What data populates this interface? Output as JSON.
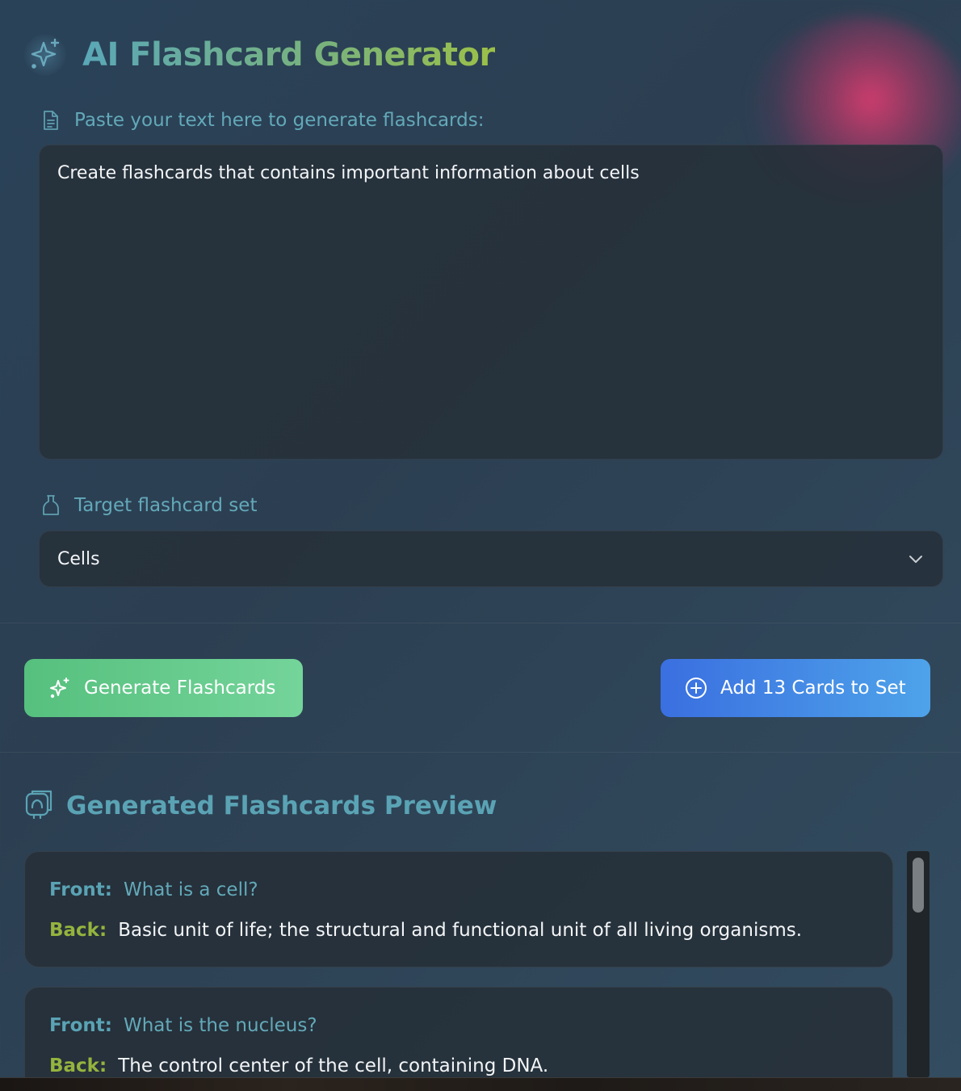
{
  "app": {
    "title": "AI Flashcard Generator",
    "title_icon": "sparkles-icon"
  },
  "input_section": {
    "label": "Paste your text here to generate flashcards:",
    "label_icon": "document-icon",
    "text_value": "Create flashcards that contains important information about cells"
  },
  "target_section": {
    "label": "Target flashcard set",
    "label_icon": "flask-icon",
    "selected_value": "Cells",
    "dropdown_icon": "chevron-down-icon"
  },
  "actions": {
    "generate_label": "Generate Flashcards",
    "generate_icon": "sparkles-icon",
    "add_label": "Add 13 Cards to Set",
    "add_icon": "plus-circle-icon"
  },
  "preview": {
    "title": "Generated Flashcards Preview",
    "icon": "cards-icon",
    "front_key": "Front:",
    "back_key": "Back:",
    "cards": [
      {
        "front": "What is a cell?",
        "back": "Basic unit of life; the structural and functional unit of all living organisms."
      },
      {
        "front": "What is the nucleus?",
        "back": "The control center of the cell, containing DNA."
      }
    ]
  },
  "colors": {
    "accent_teal": "#5aa3b4",
    "accent_green": "#94b43e",
    "generate_button": "#5ec485",
    "add_button": "#3f7fe4",
    "panel_bg": "#263039"
  }
}
